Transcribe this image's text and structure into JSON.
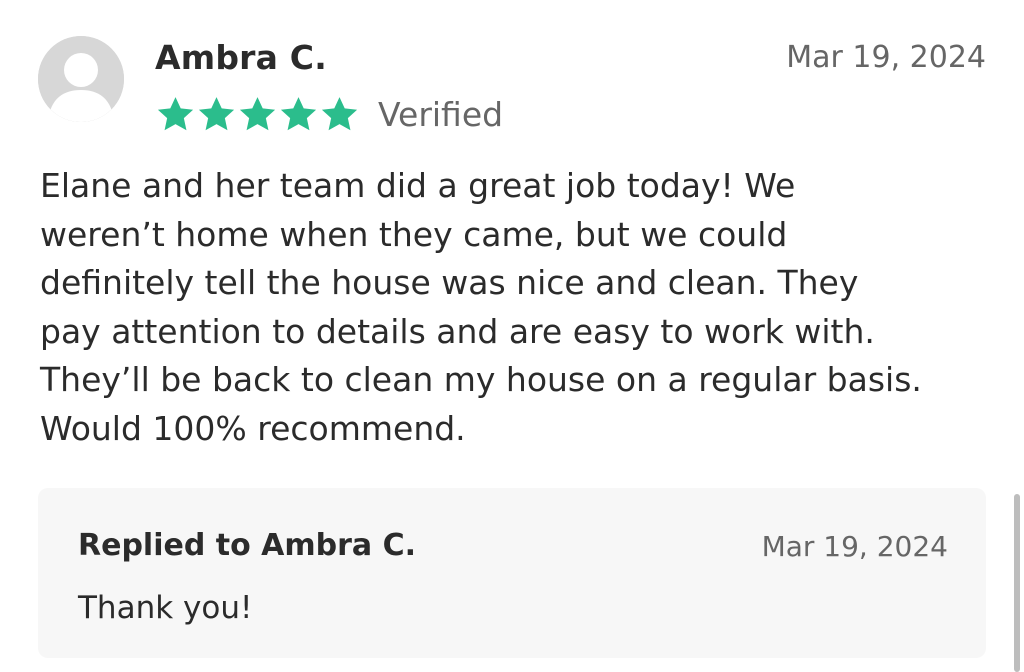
{
  "review": {
    "reviewer_name": "Ambra C.",
    "date": "Mar 19, 2024",
    "rating": 5,
    "rating_max": 5,
    "verified_label": "Verified",
    "text_lines": [
      "Elane and her team did a great job today! We",
      "weren’t home when they came, but we could",
      "definitely tell the house was nice and clean. They",
      "pay attention to details and are easy to work with.",
      "They’ll be back to clean my house on a regular basis.",
      "Would 100% recommend."
    ]
  },
  "reply": {
    "title": "Replied to Ambra C.",
    "date": "Mar 19, 2024",
    "text": "Thank you!"
  },
  "colors": {
    "star": "#2bbd8c",
    "avatar_bg": "#d7d7d7",
    "reply_bg": "#f7f7f7",
    "muted_text": "#666666"
  },
  "icons": {
    "avatar": "default-user-avatar-icon",
    "star": "star-icon"
  }
}
